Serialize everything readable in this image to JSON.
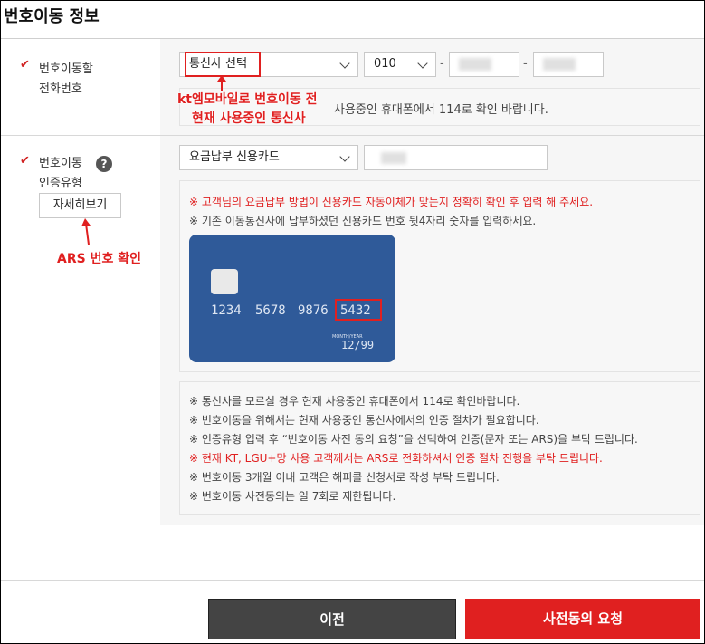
{
  "page": {
    "title": "번호이동 정보"
  },
  "row_phone": {
    "label_line1": "번호이동할",
    "label_line2": "전화번호",
    "carrier_select": "통신사 선택",
    "prefix_select": "010",
    "note": "사용중인 휴대폰에서 114로 확인 바랍니다."
  },
  "row_auth": {
    "label_line1": "번호이동",
    "label_line2": "인증유형",
    "help_icon": "?",
    "detail_button": "자세히보기",
    "auth_select": "요금납부 신용카드",
    "note_red": "※ 고객님의 요금납부 방법이 신용카드 자동이체가 맞는지 정확히 확인 후 입력 해 주세요.",
    "note_gray": "※ 기존 이동통신사에 납부하셨던 신용카드 번호 뒷4자리 숫자를 입력하세요.",
    "card": {
      "group1": "1234",
      "group2": "5678",
      "group3": "9876",
      "group4": "5432",
      "valid_label": "MONTH/YEAR",
      "expiry": "12/99"
    }
  },
  "notices": [
    {
      "text": "※ 통신사를 모르실 경우 현재 사용중인 휴대폰에서 114로 확인바랍니다.",
      "red": false
    },
    {
      "text": "※ 번호이동을 위해서는 현재 사용중인 통신사에서의 인증 절차가 필요합니다.",
      "red": false
    },
    {
      "text": "※ 인증유형 입력 후 “번호이동 사전 동의 요청”을 선택하여 인증(문자 또는 ARS)을 부탁 드립니다.",
      "red": false
    },
    {
      "text": "※ 현재 KT, LGU+망 사용 고객께서는 ARS로 전화하셔서 인증 절차 진행을 부탁 드립니다.",
      "red": true
    },
    {
      "text": "※ 번호이동 3개월 이내 고객은 해피콜 신청서로 작성 부탁 드립니다.",
      "red": false
    },
    {
      "text": "※ 번호이동 사전동의는 일 7회로 제한됩니다.",
      "red": false
    }
  ],
  "annotations": {
    "carrier_line1": "kt엠모바일로 번호이동 전",
    "carrier_line2": "현재 사용중인 통신사",
    "ars": "ARS 번호 확인"
  },
  "buttons": {
    "prev": "이전",
    "next": "사전동의 요청"
  },
  "colors": {
    "accent_red": "#e02020",
    "dark_button": "#444444",
    "card_blue": "#2f5a99"
  }
}
